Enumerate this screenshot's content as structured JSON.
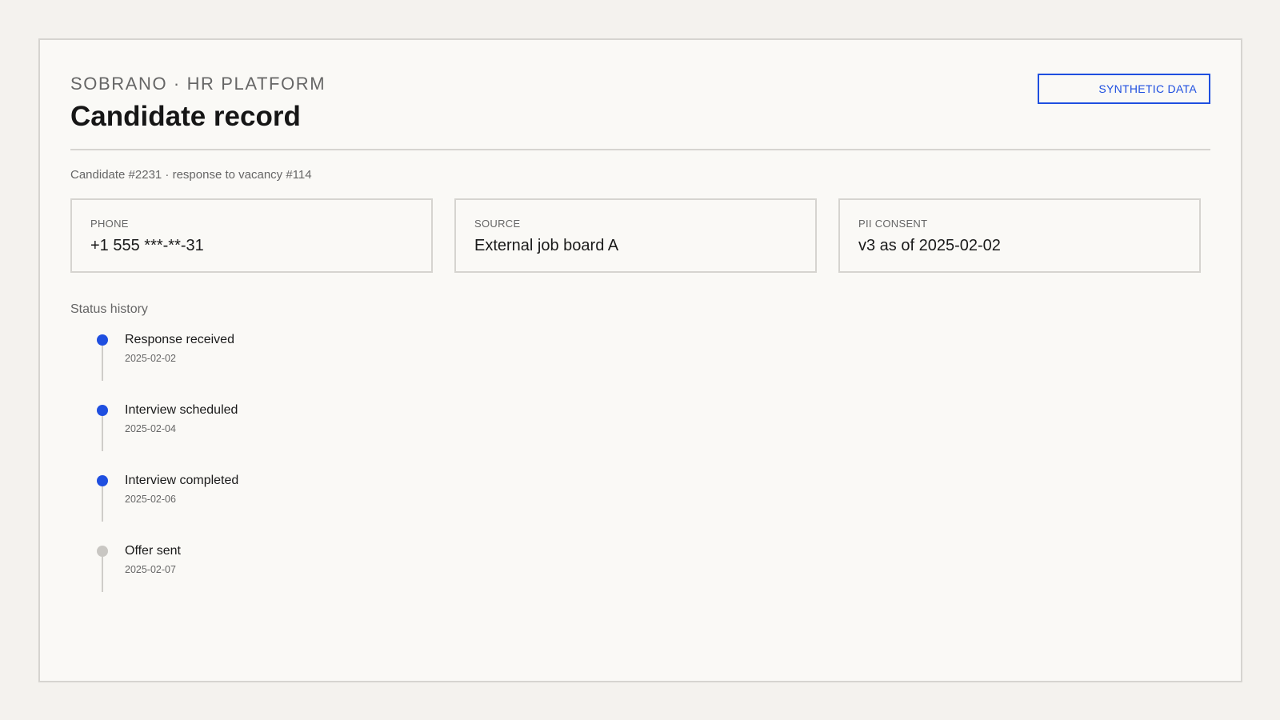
{
  "header": {
    "brand": "SOBRANO · HR PLATFORM",
    "title": "Candidate record",
    "badge": "SYNTHETIC DATA"
  },
  "meta": "Candidate #2231 · response to vacancy #114",
  "cards": [
    {
      "label": "PHONE",
      "value": "+1 555 ***-**-31"
    },
    {
      "label": "SOURCE",
      "value": "External job board A"
    },
    {
      "label": "PII CONSENT",
      "value": "v3 as of 2025-02-02"
    }
  ],
  "history": {
    "label": "Status history",
    "items": [
      {
        "title": "Response received",
        "date": "2025-02-02",
        "status": "done"
      },
      {
        "title": "Interview scheduled",
        "date": "2025-02-04",
        "status": "done"
      },
      {
        "title": "Interview completed",
        "date": "2025-02-06",
        "status": "done"
      },
      {
        "title": "Offer sent",
        "date": "2025-02-07",
        "status": "pending"
      }
    ]
  },
  "colors": {
    "accent": "#1f4fe0",
    "pending": "#c9c7c3"
  }
}
